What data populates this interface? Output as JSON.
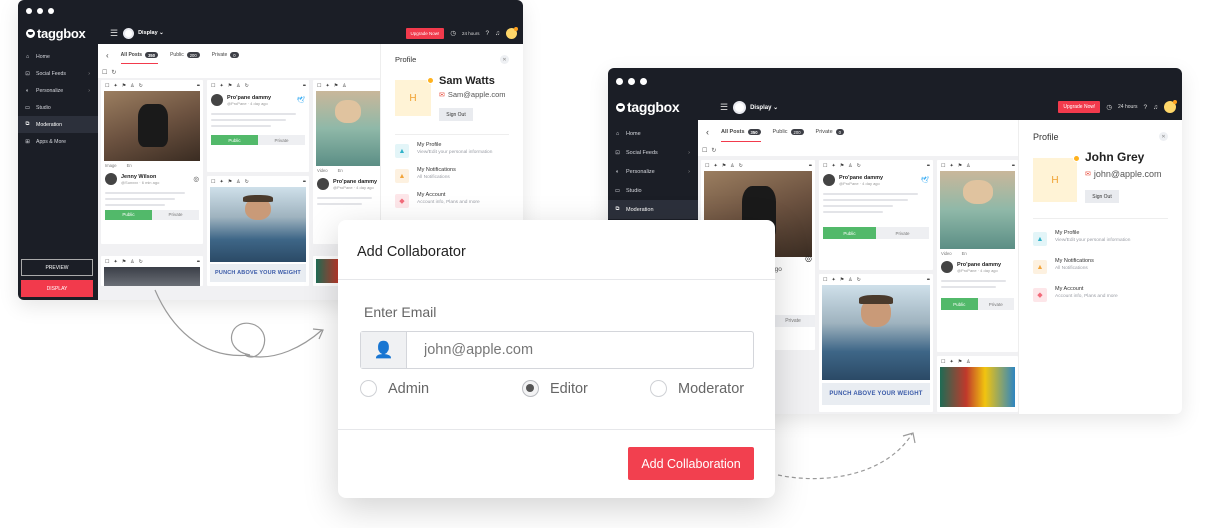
{
  "app": {
    "logo": "taggbox"
  },
  "topbar": {
    "display_label": "Display ⌄",
    "upgrade": "Upgrade Now!",
    "timer": "24 hours"
  },
  "sidebar": {
    "items": [
      {
        "label": "Home",
        "icon": "home-icon"
      },
      {
        "label": "Social Feeds",
        "icon": "feeds-icon"
      },
      {
        "label": "Personalize",
        "icon": "personalize-icon"
      },
      {
        "label": "Studio",
        "icon": "studio-icon"
      },
      {
        "label": "Moderation",
        "icon": "moderation-icon"
      },
      {
        "label": "Apps & More",
        "icon": "apps-icon"
      }
    ],
    "preview": "PREVIEW",
    "display": "DISPLAY"
  },
  "tabs": [
    {
      "label": "All Posts",
      "count": "350"
    },
    {
      "label": "Public",
      "count": "200"
    },
    {
      "label": "Private",
      "count": "0"
    }
  ],
  "posts": {
    "kettle_author": "Jenny Wilson",
    "kettle_sub": "@Sunxxx · 6 min ago",
    "meta_image": "Image",
    "meta_en": "En",
    "meta_video": "Video",
    "twitter_author": "Pro'pane dammy",
    "twitter_sub": "@ProPane · 4 day ago",
    "public": "Public",
    "private": "Private",
    "punch": "PUNCH ABOVE YOUR WEIGHT",
    "ago": "ago"
  },
  "profile_left": {
    "title": "Profile",
    "initial": "H",
    "name": "Sam Watts",
    "email": "Sam@apple.com",
    "signout": "Sign Out"
  },
  "profile_right": {
    "title": "Profile",
    "initial": "H",
    "name": "John Grey",
    "email": "john@apple.com",
    "signout": "Sign Out"
  },
  "profile_menu": [
    {
      "title": "My Profile",
      "sub": "View/Edit your personal information",
      "color": "#2fb2c9"
    },
    {
      "title": "My Notifications",
      "sub": "All Notifications",
      "color": "#f2a43a"
    },
    {
      "title": "My Account",
      "sub": "Account info, Plans and more",
      "color": "#f26b7a"
    }
  ],
  "modal": {
    "title": "Add Collaborator",
    "field_label": "Enter Email",
    "email_value": "john@apple.com",
    "roles": [
      "Admin",
      "Editor",
      "Moderator"
    ],
    "selected_role": "Editor",
    "submit": "Add Collaboration"
  },
  "colors": {
    "accent": "#f2404f",
    "dark": "#1b1e26",
    "public_green": "#52b96a"
  }
}
